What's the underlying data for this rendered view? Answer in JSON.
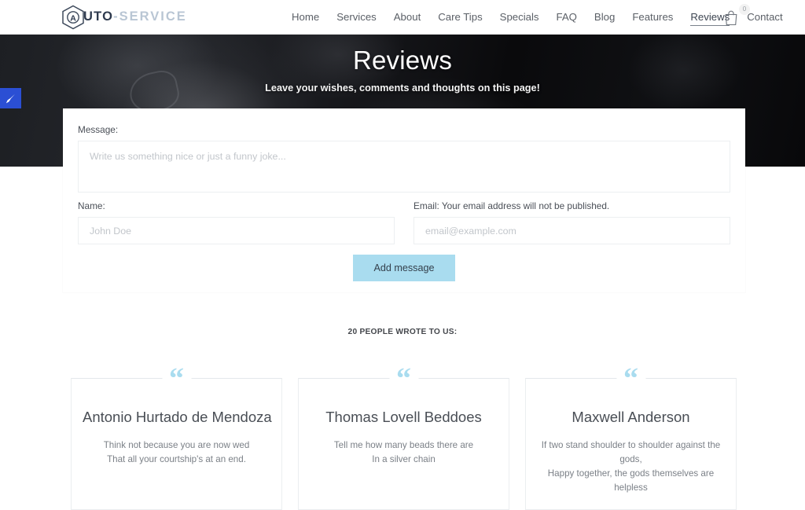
{
  "header": {
    "logo": {
      "icon": "hexagon-a-icon",
      "main": "UTO",
      "accent": "-SERVICE",
      "letter": "A"
    },
    "nav": [
      {
        "label": "Home",
        "active": false
      },
      {
        "label": "Services",
        "active": false
      },
      {
        "label": "About",
        "active": false
      },
      {
        "label": "Care Tips",
        "active": false
      },
      {
        "label": "Specials",
        "active": false
      },
      {
        "label": "FAQ",
        "active": false
      },
      {
        "label": "Blog",
        "active": false
      },
      {
        "label": "Features",
        "active": false
      },
      {
        "label": "Reviews",
        "active": true
      },
      {
        "label": "Contact",
        "active": false
      }
    ],
    "cart": {
      "icon": "shopping-bag-icon",
      "count": "0"
    }
  },
  "edit_tab": {
    "icon": "paintbrush-icon",
    "color": "#2b4fd4"
  },
  "hero": {
    "title": "Reviews",
    "subtitle": "Leave your wishes, comments and thoughts on this page!"
  },
  "form": {
    "message_label": "Message:",
    "message_placeholder": "Write us something nice or just a funny joke...",
    "message_value": "",
    "name_label": "Name:",
    "name_placeholder": "John Doe",
    "name_value": "",
    "email_label": "Email: Your email address will not be published.",
    "email_placeholder": "email@example.com",
    "email_value": "",
    "submit_label": "Add message",
    "submit_color": "#a9dcef"
  },
  "reviews": {
    "count_text": "20 PEOPLE WROTE TO US:",
    "quote_glyph": "“",
    "quote_color": "#a9dcef",
    "cards": [
      {
        "name": "Antonio Hurtado de Mendoza",
        "line1": "Think not because you are now wed",
        "line2": "That all your courtship's at an end."
      },
      {
        "name": "Thomas Lovell Beddoes",
        "line1": "Tell me how many beads there are",
        "line2": "In a silver chain"
      },
      {
        "name": "Maxwell Anderson",
        "line1": "If two stand shoulder to shoulder against the gods,",
        "line2": "Happy together, the gods themselves are helpless"
      }
    ]
  }
}
